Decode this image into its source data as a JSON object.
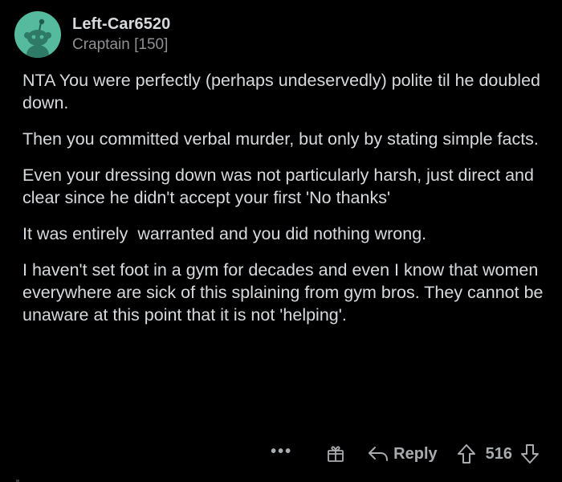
{
  "comment": {
    "author": "Left-Car6520",
    "flair": "Craptain [150]",
    "paragraphs": [
      "NTA You were perfectly (perhaps undeservedly) polite til he doubled down.",
      "Then you committed verbal murder, but only by stating simple facts.",
      "Even your dressing down was not particularly harsh, just direct and clear since he didn't accept your first 'No thanks'",
      "It was entirely  warranted and you did nothing wrong.",
      "I haven't set foot in a gym for decades and even I know that women everywhere are sick of this splaining from gym bros. They cannot be unaware at this point that it is not 'helping'."
    ]
  },
  "actions": {
    "more_label": "•••",
    "reply_label": "Reply",
    "score": "516"
  },
  "icons": {
    "avatar": "snoo-avatar-icon",
    "more": "more-options-icon",
    "award": "gift-award-icon",
    "reply": "reply-arrow-icon",
    "upvote": "upvote-arrow-icon",
    "downvote": "downvote-arrow-icon"
  },
  "colors": {
    "background": "#000000",
    "text": "#d7dadc",
    "muted": "#8e9092",
    "avatar_bg": "#56ba9f",
    "action": "#a9acaf"
  }
}
